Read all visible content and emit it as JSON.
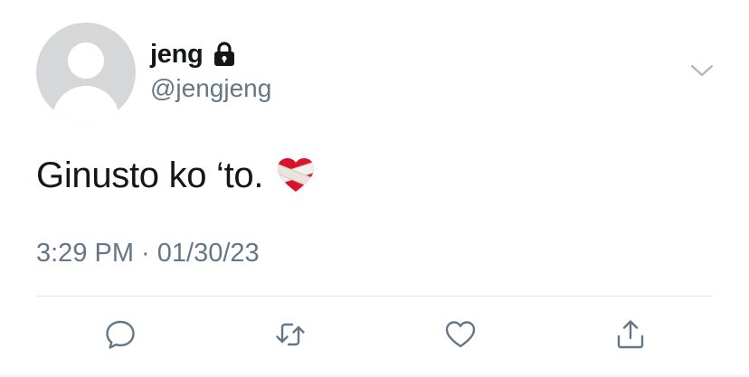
{
  "author": {
    "display_name": "jeng",
    "handle": "@jengjeng",
    "protected_icon": "lock-icon",
    "avatar_icon": "default-avatar"
  },
  "tweet": {
    "text": "Ginusto ko ‘to.",
    "emoji": "mending-heart-emoji",
    "timestamp": "3:29 PM · 01/30/23"
  },
  "menu": {
    "icon": "chevron-down-icon"
  },
  "actions": [
    {
      "name": "reply",
      "icon": "reply-icon"
    },
    {
      "name": "retweet",
      "icon": "retweet-icon"
    },
    {
      "name": "like",
      "icon": "heart-icon"
    },
    {
      "name": "share",
      "icon": "share-icon"
    }
  ],
  "colors": {
    "text_primary": "#14171a",
    "text_secondary": "#657786",
    "icon_gray": "#657786",
    "divider": "#e1e8ed",
    "avatar_bg": "#d6d7d8"
  }
}
